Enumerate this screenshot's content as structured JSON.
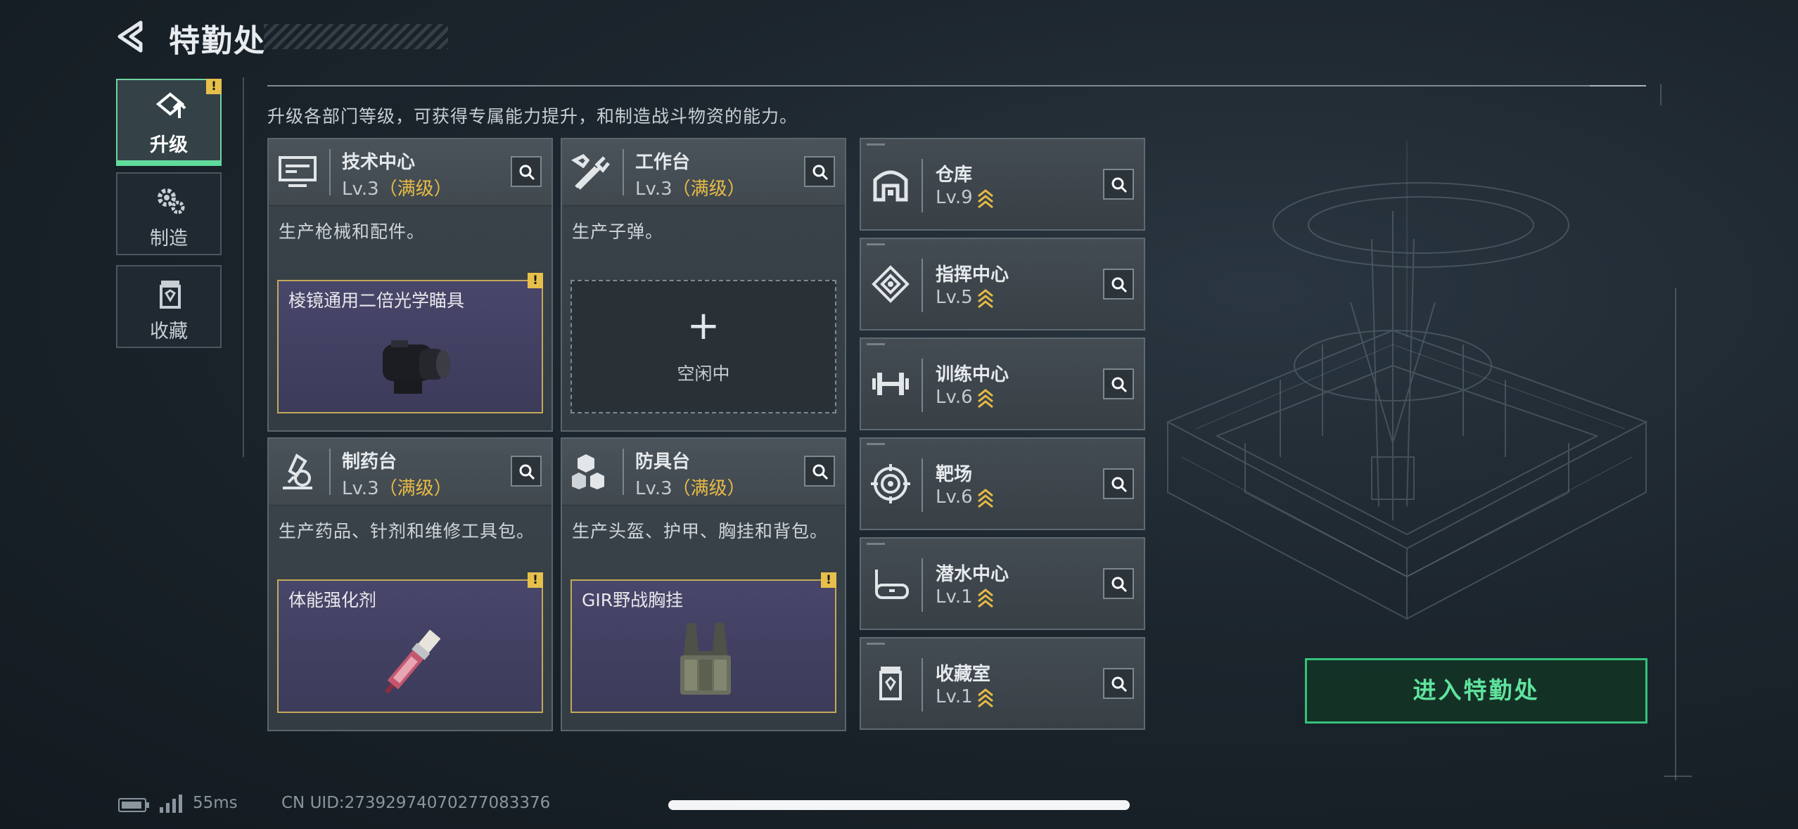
{
  "header": {
    "title": "特勤处"
  },
  "nav": {
    "items": [
      {
        "label": "升级",
        "icon": "upgrade-icon",
        "active": true,
        "alert": "!"
      },
      {
        "label": "制造",
        "icon": "gears-icon",
        "active": false
      },
      {
        "label": "收藏",
        "icon": "collection-icon",
        "active": false
      }
    ]
  },
  "description": "升级各部门等级，可获得专属能力提升，和制造战斗物资的能力。",
  "stations": [
    {
      "name": "技术中心",
      "level": "Lv.3",
      "status": "（满级）",
      "desc": "生产枪械和配件。",
      "icon": "computer-icon",
      "product": {
        "name": "棱镜通用二倍光学瞄具",
        "icon": "scope-icon",
        "alert": "!"
      }
    },
    {
      "name": "工作台",
      "level": "Lv.3",
      "status": "（满级）",
      "desc": "生产子弹。",
      "icon": "tools-icon",
      "empty": {
        "plus": "+",
        "label": "空闲中"
      }
    },
    {
      "name": "制药台",
      "level": "Lv.3",
      "status": "（满级）",
      "desc": "生产药品、针剂和维修工具包。",
      "icon": "microscope-icon",
      "product": {
        "name": "体能强化剂",
        "icon": "syringe-icon",
        "alert": "!"
      }
    },
    {
      "name": "防具台",
      "level": "Lv.3",
      "status": "（满级）",
      "desc": "生产头盔、护甲、胸挂和背包。",
      "icon": "armor-blocks-icon",
      "product": {
        "name": "GIR野战胸挂",
        "icon": "chest-rig-icon",
        "alert": "!"
      }
    }
  ],
  "facilities": [
    {
      "name": "仓库",
      "level": "Lv.9",
      "icon": "warehouse-icon"
    },
    {
      "name": "指挥中心",
      "level": "Lv.5",
      "icon": "command-icon"
    },
    {
      "name": "训练中心",
      "level": "Lv.6",
      "icon": "dumbbell-icon"
    },
    {
      "name": "靶场",
      "level": "Lv.6",
      "icon": "target-icon"
    },
    {
      "name": "潜水中心",
      "level": "Lv.1",
      "icon": "diving-mask-icon"
    },
    {
      "name": "收藏室",
      "level": "Lv.1",
      "icon": "collection-room-icon"
    }
  ],
  "enter_button": "进入特勤处",
  "status": {
    "ping": "55ms",
    "uid": "CN UID:27392974070277083376"
  },
  "colors": {
    "accent": "#5fdc9c",
    "gold": "#e8bb45",
    "slot_border": "#c4a95a",
    "slot_bg": "#45436a"
  }
}
